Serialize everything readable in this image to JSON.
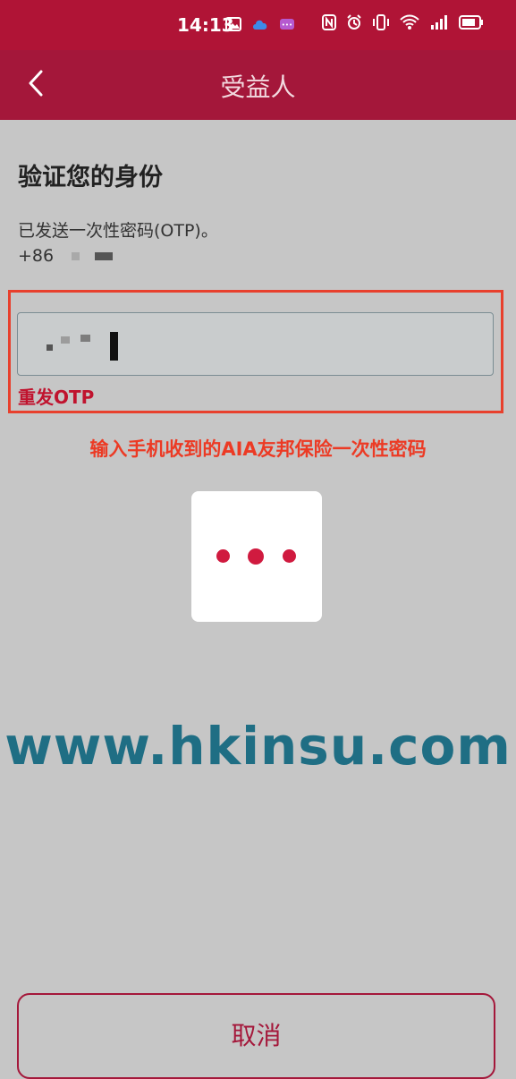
{
  "status_bar": {
    "time": "14:13",
    "left_icons": [
      "photo-notification-icon",
      "cloud-icon",
      "app-notification-icon"
    ],
    "right_icons": [
      "nfc-icon",
      "alarm-icon",
      "vibrate-icon",
      "wifi-icon",
      "signal-icon",
      "battery-icon"
    ]
  },
  "header": {
    "title": "受益人"
  },
  "main": {
    "section_title": "验证您的身份",
    "otp_sent_text": "已发送一次性密码(OTP)。",
    "phone_prefix": "+86",
    "resend_label": "重发OTP"
  },
  "annotation": {
    "text": "输入手机收到的AIA友邦保险一次性密码"
  },
  "watermark": {
    "text": "www.hkinsu.com"
  },
  "footer": {
    "cancel_label": "取消"
  },
  "colors": {
    "header_bg": "#a4173a",
    "status_bg": "#b01436",
    "accent": "#c0132e",
    "annotation": "#ec3a24",
    "watermark": "#1f6e84",
    "page_bg": "#c6c6c6"
  }
}
